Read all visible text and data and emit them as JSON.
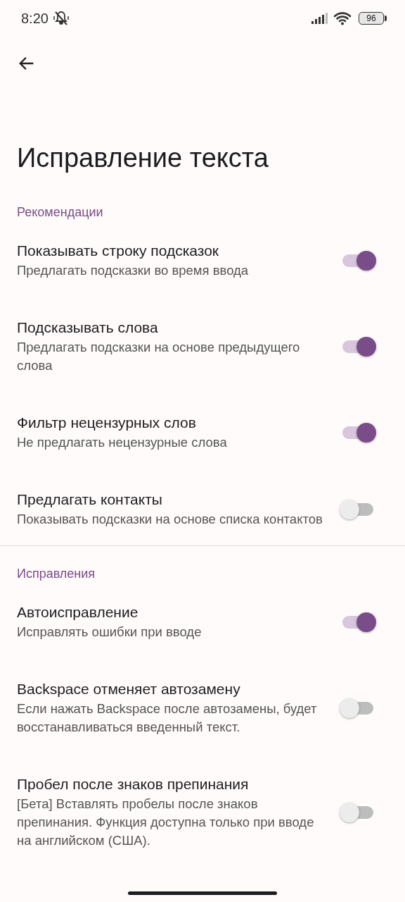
{
  "status_bar": {
    "time": "8:20",
    "battery": "96"
  },
  "title": "Исправление текста",
  "sections": [
    {
      "header": "Рекомендации",
      "items": [
        {
          "title": "Показывать строку подсказок",
          "summary": "Предлагать подсказки во время ввода",
          "on": true
        },
        {
          "title": "Подсказывать слова",
          "summary": "Предлагать подсказки на основе предыдущего слова",
          "on": true
        },
        {
          "title": "Фильтр нецензурных слов",
          "summary": "Не предлагать нецензурные слова",
          "on": true
        },
        {
          "title": "Предлагать контакты",
          "summary": "Показывать подсказки на основе списка контактов",
          "on": false
        }
      ]
    },
    {
      "header": "Исправления",
      "items": [
        {
          "title": "Автоисправление",
          "summary": "Исправлять ошибки при вводе",
          "on": true
        },
        {
          "title": "Backspace отменяет автозамену",
          "summary": "Если нажать Backspace после автозамены, будет восстанавливаться введенный текст.",
          "on": false
        },
        {
          "title": "Пробел после знаков препинания",
          "summary": "[Бета] Вставлять пробелы после знаков препинания. Функция доступна только при вводе на английском (США).",
          "on": false
        }
      ]
    }
  ]
}
